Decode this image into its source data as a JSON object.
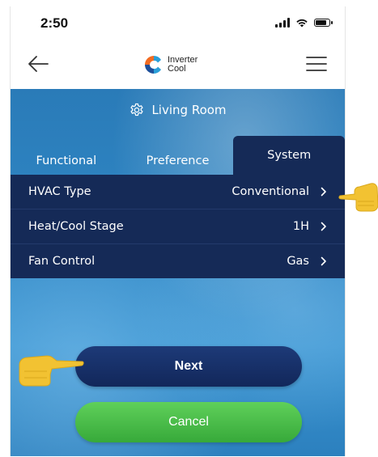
{
  "status_bar": {
    "time": "2:50",
    "icons": [
      "signal-icon",
      "wifi-icon",
      "battery-icon"
    ]
  },
  "nav": {
    "back_icon": "arrow-left-icon",
    "menu_icon": "hamburger-menu-icon",
    "logo_line1": "Inverter",
    "logo_line2": "Cool"
  },
  "room": {
    "icon": "gear-icon",
    "name": "Living Room"
  },
  "tabs": [
    {
      "label": "Functional",
      "active": false
    },
    {
      "label": "Preference",
      "active": false
    },
    {
      "label": "System",
      "active": true
    }
  ],
  "settings": [
    {
      "label": "HVAC Type",
      "value": "Conventional"
    },
    {
      "label": "Heat/Cool Stage",
      "value": "1H"
    },
    {
      "label": "Fan Control",
      "value": "Gas"
    }
  ],
  "buttons": {
    "next_label": "Next",
    "cancel_label": "Cancel"
  },
  "colors": {
    "accent_navy": "#152a57",
    "background_blue": "#2f86c4",
    "cancel_green": "#44b542",
    "hand_yellow": "#f2c232"
  }
}
